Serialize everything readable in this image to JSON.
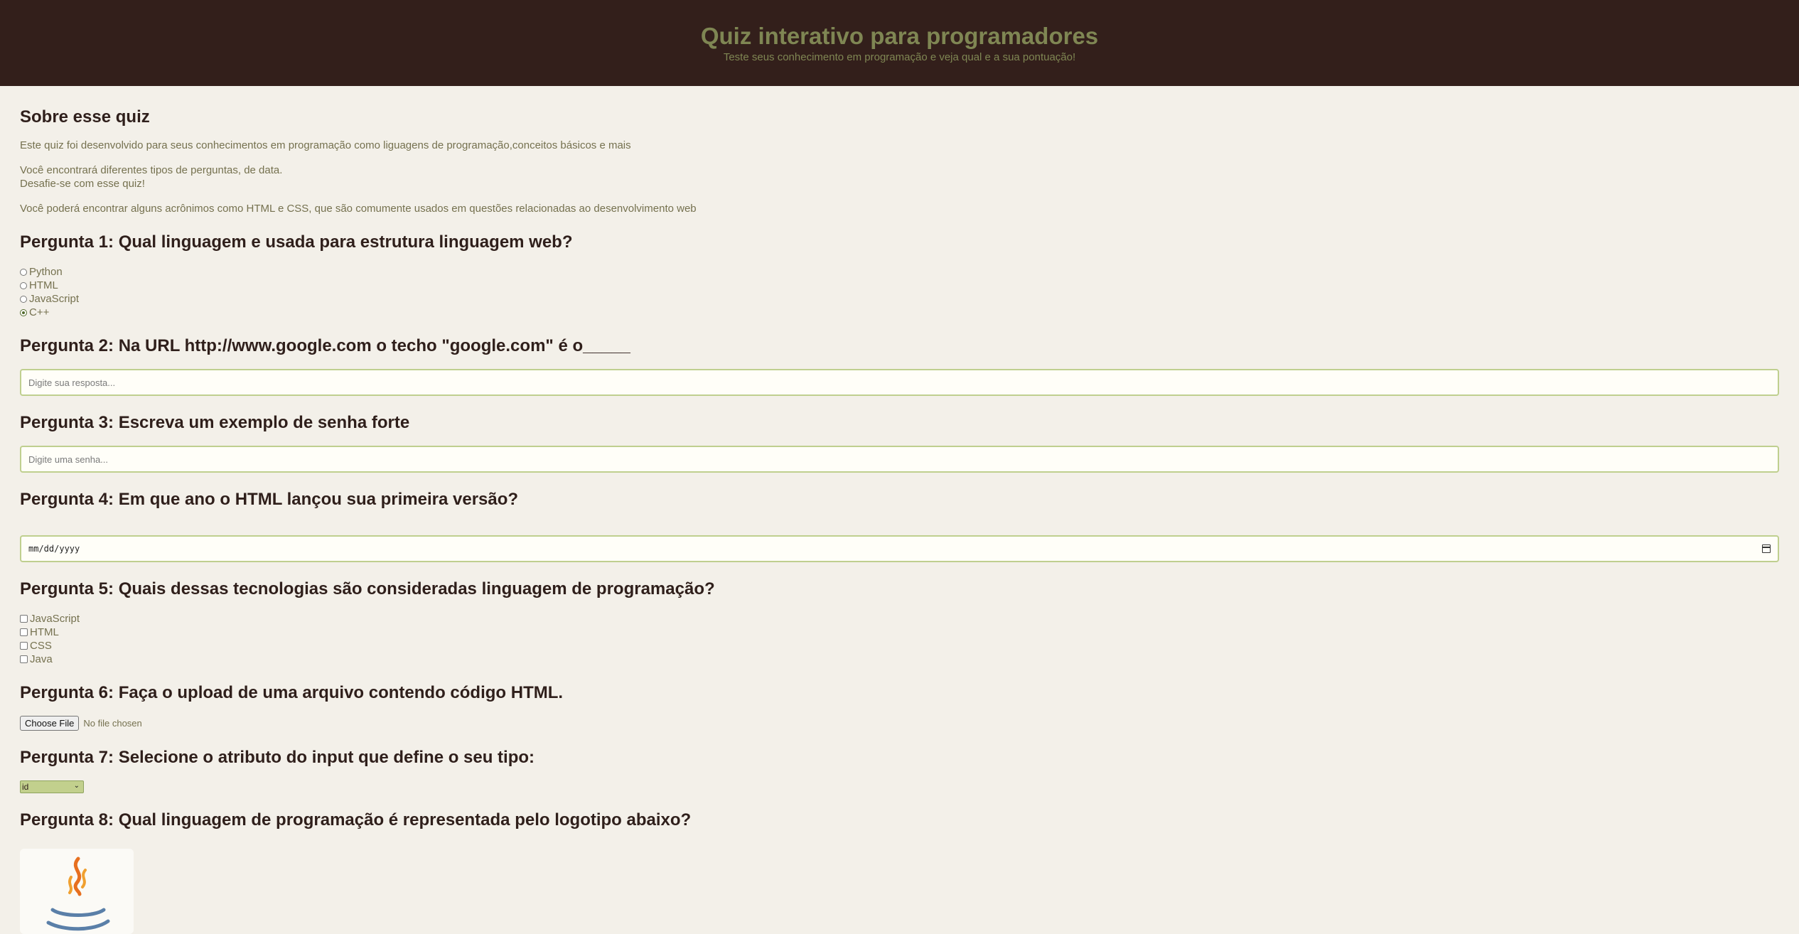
{
  "header": {
    "title": "Quiz interativo para programadores",
    "subtitle": "Teste seus conhecimento em programação e veja qual e a sua pontuação!"
  },
  "about": {
    "title": "Sobre esse quiz",
    "p1": "Este quiz foi desenvolvido para seus conhecimentos em programação como liguagens de programação,conceitos básicos e mais",
    "p2_line1": "Você encontrará diferentes tipos de perguntas, de data.",
    "p2_line2": "Desafie-se com esse quiz!",
    "p3": "Você poderá encontrar alguns acrônimos como HTML e CSS, que são comumente usados em questões relacionadas ao desenvolvimento web"
  },
  "q1": {
    "title": "Pergunta 1: Qual linguagem e usada para estrutura linguagem web?",
    "options": [
      "Python",
      "HTML",
      "JavaScript",
      "C++"
    ],
    "selected": "C++"
  },
  "q2": {
    "title": "Pergunta 2: Na URL http://www.google.com o techo \"google.com\" é o_____",
    "placeholder": "Digite sua resposta..."
  },
  "q3": {
    "title": "Pergunta 3: Escreva um exemplo de senha forte",
    "placeholder": "Digite uma senha..."
  },
  "q4": {
    "title": "Pergunta 4: Em que ano o HTML lançou sua primeira versão?",
    "date_placeholder": "mm/dd/yyyy"
  },
  "q5": {
    "title": "Pergunta 5: Quais dessas tecnologias são consideradas linguagem de programação?",
    "options": [
      "JavaScript",
      "HTML",
      "CSS",
      "Java"
    ]
  },
  "q6": {
    "title": "Pergunta 6: Faça o upload de uma arquivo contendo código HTML.",
    "button_label": "Choose File",
    "status": "No file chosen"
  },
  "q7": {
    "title": "Pergunta 7: Selecione o atributo do input que define o seu tipo:",
    "selected": "id"
  },
  "q8": {
    "title": "Pergunta 8: Qual linguagem de programação é representada pelo logotipo abaixo?",
    "logo_icon": "java-logo-icon"
  }
}
